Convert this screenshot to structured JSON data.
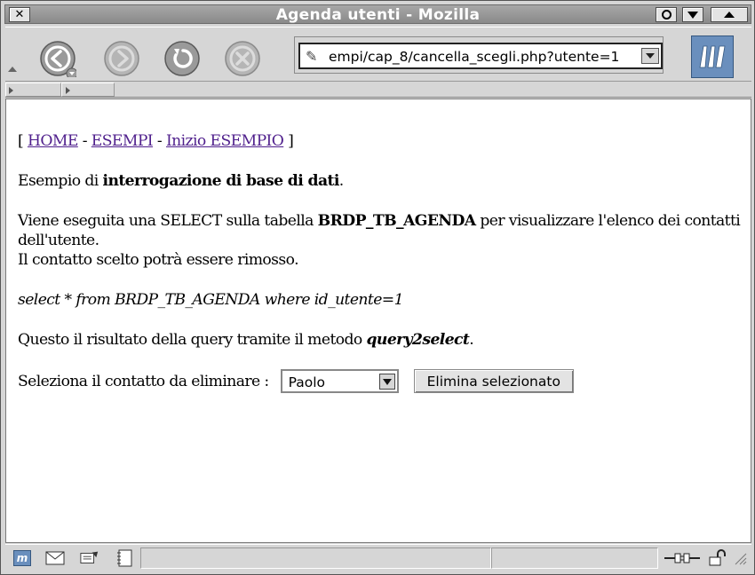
{
  "window": {
    "title": "Agenda utenti - Mozilla"
  },
  "navigation": {
    "url": "empi/cap_8/cancella_scegli.php?utente=1",
    "back_icon": "back-arrow-icon",
    "forward_icon": "forward-arrow-icon",
    "reload_icon": "reload-icon",
    "stop_icon": "stop-icon"
  },
  "page": {
    "breadcrumb": {
      "open": "[",
      "home": "HOME",
      "sep1": "-",
      "esempi": "ESEMPI",
      "sep2": "-",
      "inizio": "Inizio ESEMPIO",
      "close": "]"
    },
    "intro": {
      "prefix": "Esempio di ",
      "bold": "interrogazione di base di dati",
      "suffix": "."
    },
    "description": {
      "prefix": "Viene eseguita una SELECT sulla tabella ",
      "table": "BRDP_TB_AGENDA",
      "suffix": " per visualizzare l'elenco dei contatti dell'utente.",
      "line2": "Il contatto scelto potrà essere rimosso."
    },
    "query": "select * from BRDP_TB_AGENDA where id_utente=1",
    "result": {
      "prefix": "Questo il risultato della query tramite il metodo ",
      "method": "query2select",
      "suffix": "."
    },
    "form": {
      "label": "Seleziona il contatto da eliminare :",
      "selected": "Paolo",
      "button": "Elimina selezionato"
    }
  },
  "colors": {
    "link": "#4f1f8c",
    "logo": "#6a8fbd"
  }
}
